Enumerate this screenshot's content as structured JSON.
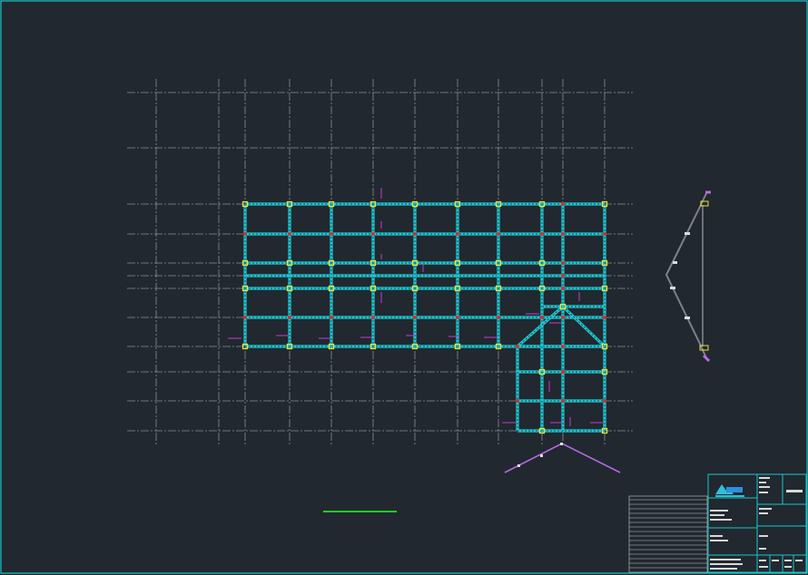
{
  "drawing": {
    "colors": {
      "background": "#212830",
      "border": "#19c9c9",
      "axis": "#8a8f94",
      "beam": "#1fc9d3",
      "column": "#e8e23a",
      "joint": "#d22b2b",
      "section_mark": "#c23bd6",
      "roof_line": "#b86ae0",
      "elevation": "#7d8287",
      "scale_bar": "#22cc22",
      "title_block": "#19c9c9",
      "revision_lines": "#c9c9c9"
    },
    "icons": {
      "logo": "company-logo-icon"
    }
  }
}
